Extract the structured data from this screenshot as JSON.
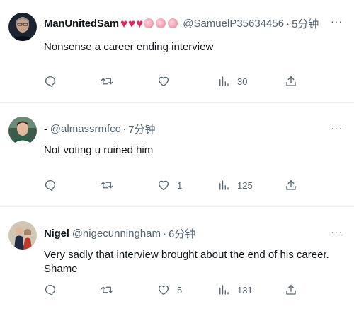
{
  "tweets": [
    {
      "name": "ManUnitedSam",
      "emojis": [
        "red-heart",
        "red-heart",
        "red-heart",
        "brain",
        "brain",
        "brain"
      ],
      "handle": "@SamuelP35634456",
      "time": "5分钟",
      "text": "Nonsense a career ending interview",
      "replies": "",
      "retweets": "",
      "likes": "",
      "views": "30"
    },
    {
      "name": "-",
      "emojis": [],
      "handle": "@almassrmfcc",
      "time": "7分钟",
      "text": "Not voting u ruined him",
      "replies": "",
      "retweets": "",
      "likes": "1",
      "views": "125"
    },
    {
      "name": "Nigel",
      "emojis": [],
      "handle": "@nigecunningham",
      "time": "6分钟",
      "text": "Very sadly that interview brought about the end of his career.  Shame",
      "replies": "",
      "retweets": "",
      "likes": "5",
      "views": "131"
    }
  ],
  "separator": "·",
  "more_label": "···",
  "icons": {
    "reply": "reply-icon",
    "retweet": "retweet-icon",
    "like": "like-icon",
    "views": "views-icon",
    "share": "share-icon",
    "more": "more-icon"
  },
  "colors": {
    "text": "#0f1419",
    "secondary": "#536471",
    "heart": "#e0245e",
    "border": "#eff3f4"
  }
}
